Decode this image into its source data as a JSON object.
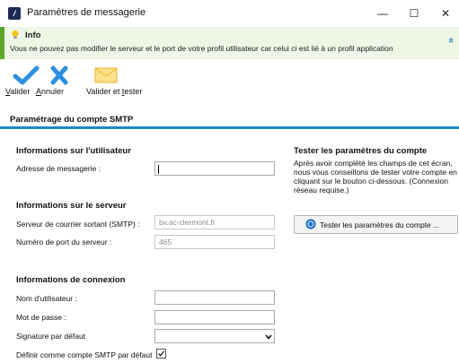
{
  "window": {
    "title": "Paramètres de messagerie",
    "minimize_glyph": "—",
    "maximize_glyph": "☐",
    "close_glyph": "✕"
  },
  "info": {
    "title": "Info",
    "message": "Vous ne pouvez pas modifier le serveur et le port de votre profil utilisateur car celui ci est lié à un profil application",
    "icon": "lightbulb-icon",
    "expand_glyph": "«"
  },
  "toolbar": {
    "validate": {
      "underline": "V",
      "rest": "alider",
      "icon": "checkmark-icon"
    },
    "cancel": {
      "underline": "A",
      "rest": "nnuler",
      "icon": "cross-icon"
    },
    "validate_test": {
      "label_pre": "Valider et ",
      "underline": "t",
      "rest": "ester",
      "icon": "envelope-icon"
    }
  },
  "section": {
    "title": "Paramétrage du compte SMTP",
    "accent_color": "#1f86c8"
  },
  "user_info": {
    "title": "Informations sur l'utilisateur",
    "email_label": "Adresse de messagerie :",
    "email_value": ""
  },
  "server_info": {
    "title": "Informations sur le serveur",
    "smtp_label": "Serveur de courrier sortant (SMTP) :",
    "smtp_value": "bv.ac-clermont.fr",
    "port_label": "Numéro de port du serveur :",
    "port_value": "465"
  },
  "connection_info": {
    "title": "Informations de connexion",
    "username_label": "Nom d'utilisateur :",
    "username_value": "",
    "password_label": "Mot de passe :",
    "password_value": "",
    "signature_label": "Signature par défaut",
    "signature_value": "",
    "default_smtp_label": "Définir comme compte SMTP par défaut",
    "default_smtp_checked": true
  },
  "test_panel": {
    "title": "Tester les paramètres du compte",
    "description_lines": [
      "Après avoir complété les champs de cet écran,",
      "nous vous conseillons de tester votre compte en",
      "cliquant sur le bouton ci-dessous. (Connexion",
      "réseau requise.)"
    ],
    "button_label": "Tester les paramètres du compte ..."
  }
}
